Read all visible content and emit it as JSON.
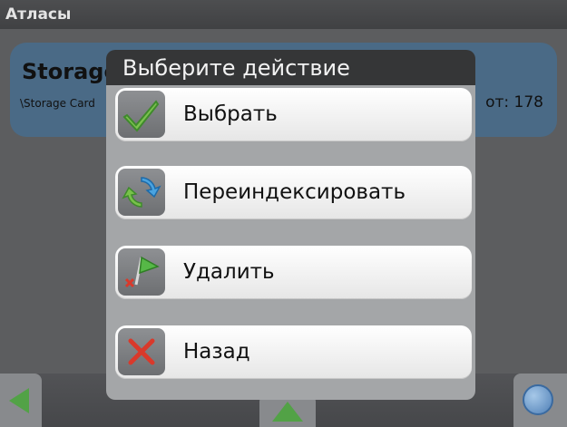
{
  "header": {
    "title": "Атласы"
  },
  "storage": {
    "name": "Storage Card",
    "path": "\\Storage Card",
    "count_label": "от: 178"
  },
  "dialog": {
    "title": "Выберите действие",
    "actions": [
      {
        "label": "Выбрать",
        "icon": "checkmark-icon"
      },
      {
        "label": "Переиндексировать",
        "icon": "refresh-icon"
      },
      {
        "label": "Удалить",
        "icon": "delete-flag-icon"
      },
      {
        "label": "Назад",
        "icon": "close-icon"
      }
    ]
  },
  "bottombar": {
    "left": "back-arrow-icon",
    "center": "up-arrow-icon",
    "right": "globe-icon"
  },
  "colors": {
    "accent_green": "#52a246",
    "card_blue": "#4a6a86",
    "dialog_dark": "#353637",
    "close_red": "#d9392b"
  }
}
